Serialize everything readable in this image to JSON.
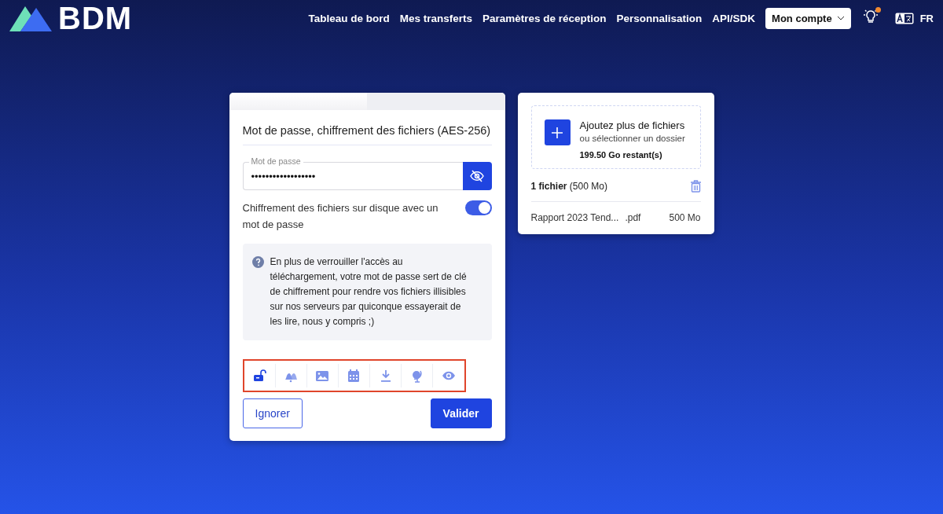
{
  "header": {
    "logo": "BDM",
    "nav": [
      {
        "label": "Tableau de bord"
      },
      {
        "label": "Mes transferts"
      },
      {
        "label": "Paramètres de réception"
      },
      {
        "label": "Personnalisation"
      },
      {
        "label": "API/SDK"
      }
    ],
    "account": "Mon compte",
    "notification": true,
    "language": "FR"
  },
  "options_card": {
    "tabs": [
      {
        "selected": true
      },
      {
        "selected": false
      }
    ],
    "title": "Mot de passe, chiffrement des fichiers (AES-256)",
    "password": {
      "label": "Mot de passe",
      "value": "••••••••••••••••••"
    },
    "encryption": {
      "label": "Chiffrement des fichiers sur disque avec un mot de passe",
      "on": true
    },
    "info": "En plus de verrouiller l'accès au téléchargement, votre mot de passe sert de clé de chiffrement pour rendre vos fichiers illisibles sur nos serveurs par quiconque essayerait de les lire, nous y compris ;)",
    "option_icons": [
      {
        "kind": "lock",
        "selected": true
      },
      {
        "kind": "bells",
        "selected": false
      },
      {
        "kind": "image",
        "selected": false
      },
      {
        "kind": "calendar",
        "selected": false
      },
      {
        "kind": "download",
        "selected": false
      },
      {
        "kind": "globe",
        "selected": false
      },
      {
        "kind": "eye",
        "selected": false
      }
    ],
    "highlighted": true,
    "buttons": [
      {
        "label": "Ignorer",
        "kind": "secondary"
      },
      {
        "label": "Valider",
        "kind": "primary"
      }
    ]
  },
  "files_card": {
    "add_title": "Ajoutez plus de fichiers",
    "add_subtitle": "ou sélectionner un dossier",
    "remaining": "199.50 Go restant(s)",
    "summary": "**1 fichier** (500 Mo)",
    "files": [
      {
        "name": "Rapport 2023 Tend...",
        "ext": ".pdf",
        "size": "500 Mo"
      }
    ]
  }
}
